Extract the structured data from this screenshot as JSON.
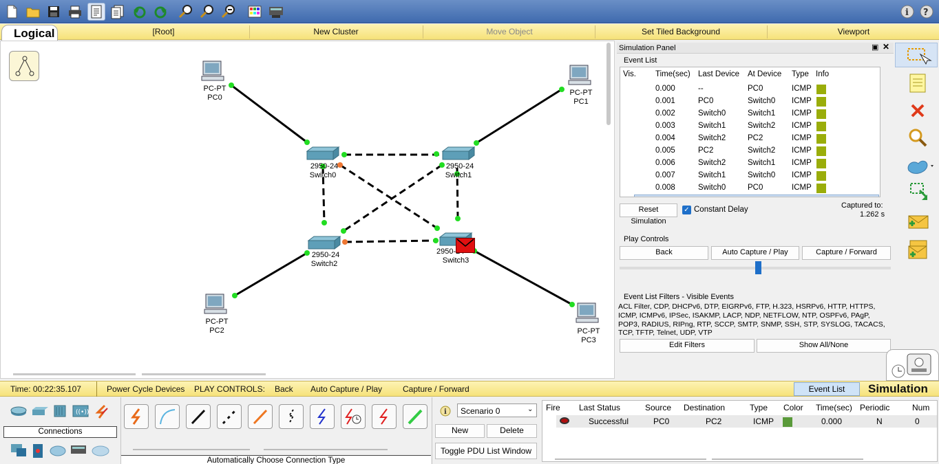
{
  "toolbar": {
    "icons": [
      "new-file-icon",
      "open-folder-icon",
      "save-icon",
      "print-icon",
      "activity-wizard-icon",
      "pdu-list-icon",
      "undo-icon",
      "redo-icon",
      "zoom-in-icon",
      "zoom-reset-icon",
      "zoom-out-icon",
      "palette-icon",
      "custom-device-icon"
    ],
    "help_icon": "info-icon"
  },
  "nav": {
    "logical_label": "Logical",
    "root": "[Root]",
    "new_cluster": "New Cluster",
    "move_object": "Move Object",
    "set_tiled_background": "Set Tiled Background",
    "viewport": "Viewport"
  },
  "topology": {
    "pcs": [
      {
        "model": "PC-PT",
        "name": "PC0"
      },
      {
        "model": "PC-PT",
        "name": "PC1"
      },
      {
        "model": "PC-PT",
        "name": "PC2"
      },
      {
        "model": "PC-PT",
        "name": "PC3"
      }
    ],
    "switches": [
      {
        "model": "2950-24",
        "name": "Switch0"
      },
      {
        "model": "2950-24",
        "name": "Switch1"
      },
      {
        "model": "2950-24",
        "name": "Switch2"
      },
      {
        "model": "2950-24",
        "name": "Switch3"
      }
    ],
    "colors": {
      "link_up": "#22dd22",
      "link_blocking": "#ee7733",
      "switch": "#5e9fb8",
      "envelope": "#e01010"
    }
  },
  "sim_panel": {
    "title": "Simulation Panel",
    "event_list_label": "Event List",
    "columns": [
      "Vis.",
      "Time(sec)",
      "Last Device",
      "At Device",
      "Type",
      "Info"
    ],
    "events": [
      {
        "time": "0.000",
        "last": "--",
        "at": "PC0",
        "type": "ICMP"
      },
      {
        "time": "0.001",
        "last": "PC0",
        "at": "Switch0",
        "type": "ICMP"
      },
      {
        "time": "0.002",
        "last": "Switch0",
        "at": "Switch1",
        "type": "ICMP"
      },
      {
        "time": "0.003",
        "last": "Switch1",
        "at": "Switch2",
        "type": "ICMP"
      },
      {
        "time": "0.004",
        "last": "Switch2",
        "at": "PC2",
        "type": "ICMP"
      },
      {
        "time": "0.005",
        "last": "PC2",
        "at": "Switch2",
        "type": "ICMP"
      },
      {
        "time": "0.006",
        "last": "Switch2",
        "at": "Switch1",
        "type": "ICMP"
      },
      {
        "time": "0.007",
        "last": "Switch1",
        "at": "Switch0",
        "type": "ICMP"
      },
      {
        "time": "0.008",
        "last": "Switch0",
        "at": "PC0",
        "type": "ICMP"
      }
    ],
    "info_color": "#9aad0a",
    "reset_simulation": "Reset Simulation",
    "constant_delay": "Constant Delay",
    "constant_delay_checked": true,
    "captured_to_label": "Captured to:",
    "captured_to_value": "1.262 s",
    "play_controls_label": "Play Controls",
    "back": "Back",
    "auto_capture_play": "Auto Capture / Play",
    "capture_forward": "Capture / Forward",
    "filters_label": "Event List Filters - Visible Events",
    "filters_text": "ACL Filter, CDP, DHCPv6, DTP, EIGRPv6, FTP, H.323, HSRPv6, HTTP, HTTPS, ICMP, ICMPv6, IPSec, ISAKMP, LACP, NDP, NETFLOW, NTP, OSPFv6, PAgP, POP3, RADIUS, RIPng, RTP, SCCP, SMTP, SNMP, SSH, STP, SYSLOG, TACACS, TCP, TFTP, Telnet, UDP, VTP",
    "edit_filters": "Edit Filters",
    "show_all_none": "Show All/None"
  },
  "right_tools": [
    "select-icon",
    "note-icon",
    "delete-icon",
    "inspect-icon",
    "draw-shape-icon",
    "resize-icon",
    "add-simple-pdu-icon",
    "add-complex-pdu-icon"
  ],
  "status_bar": {
    "time": "Time: 00:22:35.107",
    "power_cycle": "Power Cycle Devices",
    "play_controls": "PLAY CONTROLS:",
    "back": "Back",
    "auto_capture_play": "Auto Capture / Play",
    "capture_forward": "Capture / Forward",
    "event_list": "Event List",
    "simulation": "Simulation"
  },
  "device_panel": {
    "category_label": "Connections",
    "connection_type_label": "Automatically Choose Connection Type"
  },
  "scenario": {
    "selected": "Scenario 0",
    "new": "New",
    "delete": "Delete",
    "toggle": "Toggle PDU List Window"
  },
  "pdu_list": {
    "columns": [
      "Fire",
      "Last Status",
      "Source",
      "Destination",
      "Type",
      "Color",
      "Time(sec)",
      "Periodic",
      "Num"
    ],
    "rows": [
      {
        "last_status": "Successful",
        "source": "PC0",
        "destination": "PC2",
        "type": "ICMP",
        "color": "#5a9a3a",
        "time": "0.000",
        "periodic": "N",
        "num": "0"
      }
    ]
  }
}
